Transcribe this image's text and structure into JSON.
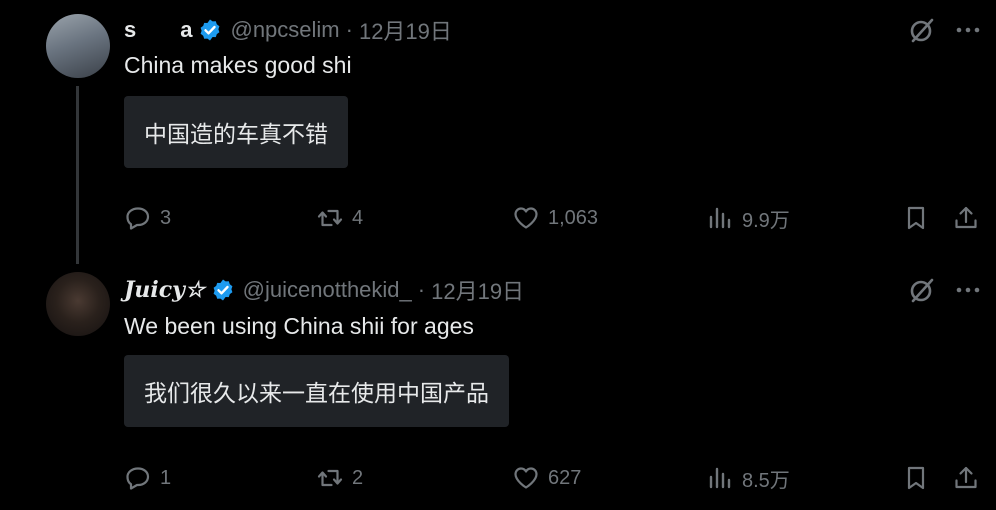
{
  "posts": [
    {
      "name": "s  a",
      "handle": "@npcselim",
      "date": "12月19日",
      "text": "China makes good shi",
      "translation": "中国造的车真不错",
      "stats": {
        "replies": "3",
        "reposts": "4",
        "likes": "1,063",
        "views": "9.9万"
      }
    },
    {
      "name": "Juicy☆",
      "handle": "@juicenotthekid_",
      "date": "12月19日",
      "text": "We been using China shii for ages",
      "translation": "我们很久以来一直在使用中国产品",
      "stats": {
        "replies": "1",
        "reposts": "2",
        "likes": "627",
        "views": "8.5万"
      }
    }
  ],
  "separator": "·",
  "colors": {
    "background": "#000000",
    "text": "#e7e9ea",
    "muted": "#71767b",
    "verified": "#1d9bf0",
    "translation_bg": "#202327"
  },
  "icons": [
    "verified-badge-icon",
    "grok-icon",
    "more-icon",
    "reply-icon",
    "retweet-icon",
    "like-icon",
    "views-icon",
    "bookmark-icon",
    "share-icon"
  ]
}
